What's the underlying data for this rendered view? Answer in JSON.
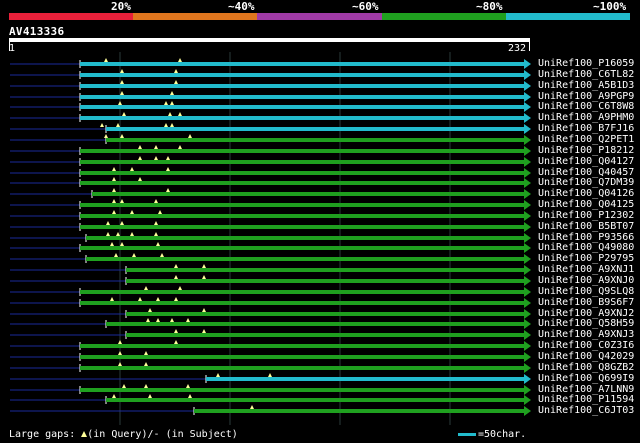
{
  "colors": {
    "legend": [
      "#e8203a",
      "#e0761e",
      "#a03aa6",
      "#1fa01f",
      "#22bbcc"
    ],
    "lowid": "#22bbcc",
    "highid": "#1fa01f",
    "grid": "#2a3a3a",
    "marker": "#ffff99",
    "gap": "#1a2a9a"
  },
  "legend_labels": [
    "20%",
    "~40%",
    "~60%",
    "~80%",
    "~100%"
  ],
  "query": {
    "name": "AV413336",
    "start": "1",
    "end": "232"
  },
  "hits": [
    {
      "name": "UniRef100_P16059",
      "color": "teal"
    },
    {
      "name": "UniRef100_C6TL82",
      "color": "teal"
    },
    {
      "name": "UniRef100_A5B1D3",
      "color": "teal"
    },
    {
      "name": "UniRef100_A9PGP9",
      "color": "teal"
    },
    {
      "name": "UniRef100_C6T8W8",
      "color": "teal"
    },
    {
      "name": "UniRef100_A9PHM0",
      "color": "teal"
    },
    {
      "name": "UniRef100_B7FJ16",
      "color": "teal"
    },
    {
      "name": "UniRef100_Q2PET1",
      "color": "green"
    },
    {
      "name": "UniRef100_P18212",
      "color": "green"
    },
    {
      "name": "UniRef100_Q04127",
      "color": "green"
    },
    {
      "name": "UniRef100_Q40457",
      "color": "green"
    },
    {
      "name": "UniRef100_Q7DM39",
      "color": "green"
    },
    {
      "name": "UniRef100_Q04126",
      "color": "green"
    },
    {
      "name": "UniRef100_Q04125",
      "color": "green"
    },
    {
      "name": "UniRef100_P12302",
      "color": "green"
    },
    {
      "name": "UniRef100_B5BT07",
      "color": "green"
    },
    {
      "name": "UniRef100_P93566",
      "color": "green"
    },
    {
      "name": "UniRef100_Q49080",
      "color": "green"
    },
    {
      "name": "UniRef100_P29795",
      "color": "green"
    },
    {
      "name": "UniRef100_A9XNJ1",
      "color": "green"
    },
    {
      "name": "UniRef100_A9XNJ0",
      "color": "green"
    },
    {
      "name": "UniRef100_Q9SLQ8",
      "color": "green"
    },
    {
      "name": "UniRef100_B9S6F7",
      "color": "green"
    },
    {
      "name": "UniRef100_A9XNJ2",
      "color": "green"
    },
    {
      "name": "UniRef100_Q58H59",
      "color": "green"
    },
    {
      "name": "UniRef100_A9XNJ3",
      "color": "green"
    },
    {
      "name": "UniRef100_C0Z3I6",
      "color": "green"
    },
    {
      "name": "UniRef100_Q42029",
      "color": "green"
    },
    {
      "name": "UniRef100_Q8GZB2",
      "color": "green"
    },
    {
      "name": "UniRef100_Q699I9",
      "color": "teal"
    },
    {
      "name": "UniRef100_A7LNN9",
      "color": "green"
    },
    {
      "name": "UniRef100_P11594",
      "color": "green"
    },
    {
      "name": "UniRef100_C6JT03",
      "color": "green"
    }
  ],
  "footer": {
    "large_gaps": "Large gaps:",
    "in_query": "(in Query)/",
    "gap_dash": "-",
    "in_subject": "(in Subject)",
    "scale": "=50char."
  }
}
